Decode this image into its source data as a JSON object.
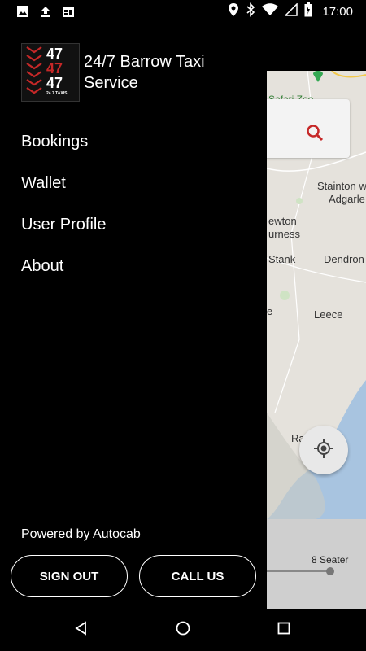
{
  "status_bar": {
    "time": "17:00"
  },
  "map": {
    "labels": {
      "zoo": "Safari Zoo",
      "stainton": "Stainton w",
      "adgarley": "Adgarle",
      "newton": "ewton",
      "furness": "urness",
      "stank": "Stank",
      "dendron": "Dendron",
      "leece": "Leece",
      "rampside": "Ra",
      "e_letter": "e"
    },
    "seater": "8 Seater"
  },
  "drawer": {
    "logo": {
      "line1": "47",
      "line2": "47",
      "line3": "47",
      "tagline": "24 7 TAXIS"
    },
    "title": "24/7 Barrow Taxi Service",
    "menu": [
      "Bookings",
      "Wallet",
      "User Profile",
      "About"
    ],
    "powered_by": "Powered by Autocab",
    "sign_out": "SIGN OUT",
    "call_us": "CALL US"
  },
  "colors": {
    "accent_red": "#c62828",
    "drawer_bg": "#000000",
    "map_water": "#a8c4e0"
  }
}
